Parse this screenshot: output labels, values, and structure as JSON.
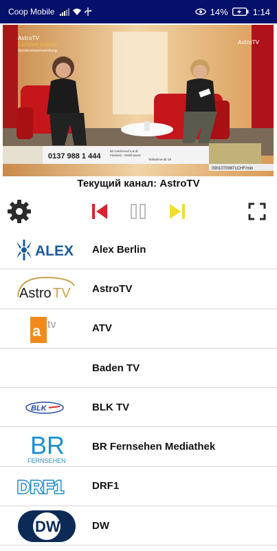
{
  "status_bar": {
    "carrier": "Coop Mobile",
    "battery_percent": "14%",
    "time": "1:14",
    "icons": [
      "signal-icon",
      "wifi-icon",
      "usb-icon",
      "eye-icon",
      "battery-icon"
    ]
  },
  "video": {
    "overlay_logo_left": "AstroTV",
    "overlay_logo_left_sub": "Lichtes Leben",
    "overlay_logo_left_caption": "Sonderstreamsendung",
    "overlay_logo_right": "AstroTV",
    "ticker_phone": "0137 988 1 444",
    "ticker_small_1": "50 Cent/Anruf a.d.dt.",
    "ticker_small_2": "Festnetz - Mobil teurer",
    "ticker_small_3": "Teilnahme ab 18",
    "ticker_right": "09010709871CHF/min"
  },
  "current_channel": {
    "label": "Текущий канал: AstroTV"
  },
  "controls": {
    "settings_icon": "gear-icon",
    "previous_icon": "skip-previous-icon",
    "pause_icon": "pause-icon",
    "next_icon": "skip-next-icon",
    "fullscreen_icon": "fullscreen-icon",
    "colors": {
      "previous": "#d9232e",
      "pause": "#bdbdbd",
      "next": "#f2dd2e",
      "icons": "#2b2b2b"
    }
  },
  "channels": [
    {
      "name": "Alex Berlin",
      "logo_text": "ALEX",
      "logo": "alex-logo"
    },
    {
      "name": "AstroTV",
      "logo_text": "AstroTV",
      "logo": "astrotv-logo"
    },
    {
      "name": "ATV",
      "logo_text": "atv",
      "logo": "atv-logo"
    },
    {
      "name": "Baden TV",
      "logo_text": "",
      "logo": ""
    },
    {
      "name": "BLK TV",
      "logo_text": "BLK",
      "logo": "blk-logo"
    },
    {
      "name": "BR Fernsehen Mediathek",
      "logo_text": "BR",
      "logo_sub": "FERNSEHEN",
      "logo": "br-logo"
    },
    {
      "name": "DRF1",
      "logo_text": "DRF1",
      "logo": "drf1-logo"
    },
    {
      "name": "DW",
      "logo_text": "DW",
      "logo": "dw-logo"
    }
  ]
}
